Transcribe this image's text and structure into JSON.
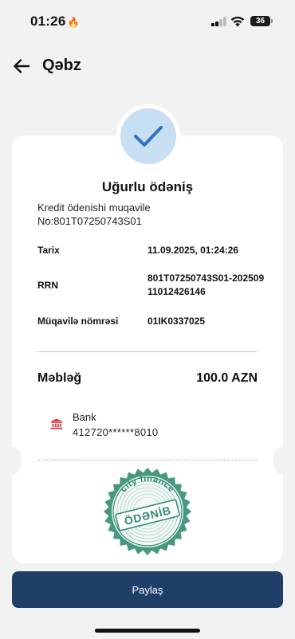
{
  "status_bar": {
    "time": "01:26",
    "battery": "36"
  },
  "header": {
    "title": "Qəbz",
    "back_icon": "arrow-left-icon"
  },
  "receipt": {
    "status_icon": "checkmark-icon",
    "title": "Uğurlu ödəniş",
    "description_line1": "Kredit ödenishi muqavile",
    "description_line2": "No:801T07250743S01",
    "details": [
      {
        "label": "Tarix",
        "value": "11.09.2025, 01:24:26"
      },
      {
        "label": "RRN",
        "value": "801T07250743S01-20250911012426146"
      },
      {
        "label": "Müqavilə nömrəsi",
        "value": "01IK0337025"
      }
    ],
    "amount_label": "Məbləğ",
    "amount_value": "100.0 AZN",
    "payment_source": {
      "icon": "bank-icon",
      "name": "Bank",
      "card_number": "412720******8010"
    },
    "stamp": {
      "brand": "city finance",
      "status": "ÖDƏNİB",
      "color": "#2e8a6e"
    }
  },
  "actions": {
    "share_label": "Paylaş"
  },
  "colors": {
    "accent": "#1f3e68",
    "check_bg": "#c8def3",
    "check_mark": "#2e75c6",
    "bank_icon": "#d43a3a"
  }
}
